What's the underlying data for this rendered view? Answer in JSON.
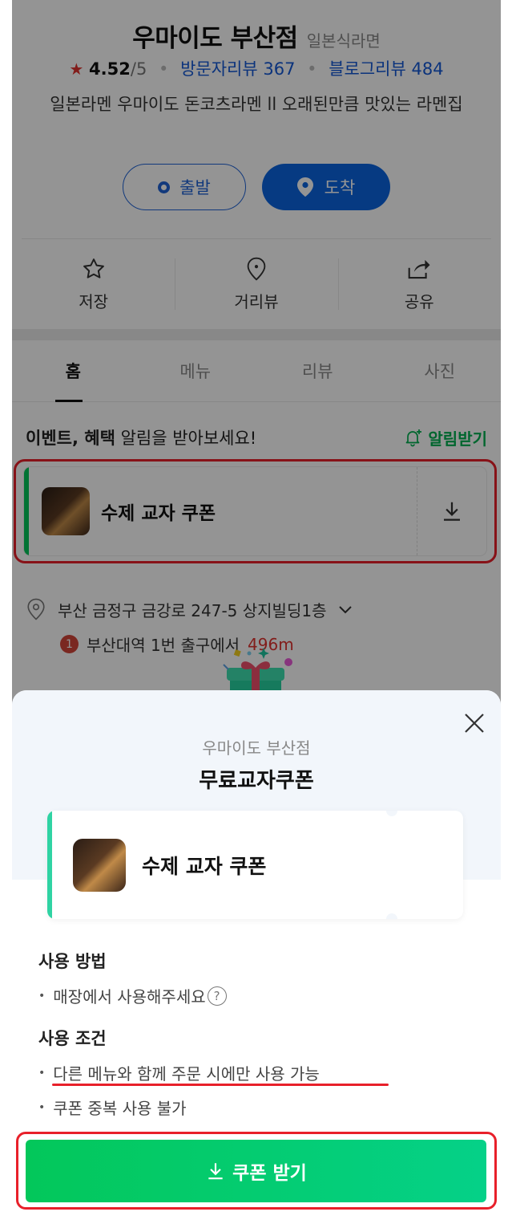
{
  "place": {
    "name": "우마이도 부산점",
    "category": "일본식라면",
    "rating": "4.52",
    "rating_max": "/5",
    "visit_reviews": "방문자리뷰 367",
    "blog_reviews": "블로그리뷰 484",
    "description": "일본라멘 우마이도 돈코츠라멘 ll 오래된만큼 맛있는 라멘집"
  },
  "route": {
    "depart_label": "출발",
    "arrive_label": "도착"
  },
  "actions": [
    {
      "label": "저장",
      "icon": "star-outline-icon"
    },
    {
      "label": "거리뷰",
      "icon": "map-pin-outline-icon"
    },
    {
      "label": "공유",
      "icon": "share-icon"
    }
  ],
  "tabs": [
    {
      "label": "홈",
      "active": true
    },
    {
      "label": "메뉴",
      "active": false
    },
    {
      "label": "리뷰",
      "active": false
    },
    {
      "label": "사진",
      "active": false
    }
  ],
  "event": {
    "text_bold": "이벤트, 혜택",
    "text_rest": " 알림을 받아보세요!",
    "alarm_label": "알림받기"
  },
  "coupon_card": {
    "name": "수제 교자 쿠폰"
  },
  "address": {
    "line": "부산 금정구 금강로 247-5 상지빌딩1층",
    "station_num": "1",
    "station": "부산대역 1번 출구에서",
    "distance": "496m"
  },
  "sheet": {
    "store": "우마이도 부산점",
    "title": "무료교자쿠폰",
    "coupon_name": "수제 교자 쿠폰",
    "usage_head": "사용 방법",
    "usage_items": [
      "매장에서 사용해주세요"
    ],
    "cond_head": "사용 조건",
    "cond_items": [
      "다른 메뉴와 함께 주문 시에만 사용 가능",
      "쿠폰 중복 사용 불가"
    ],
    "help_glyph": "?",
    "cta_label": "쿠폰 받기"
  },
  "colors": {
    "accent_green": "#03c75a",
    "brand_blue": "#0c65e0",
    "highlight_red": "#e8202a",
    "star_red": "#e0332f"
  }
}
